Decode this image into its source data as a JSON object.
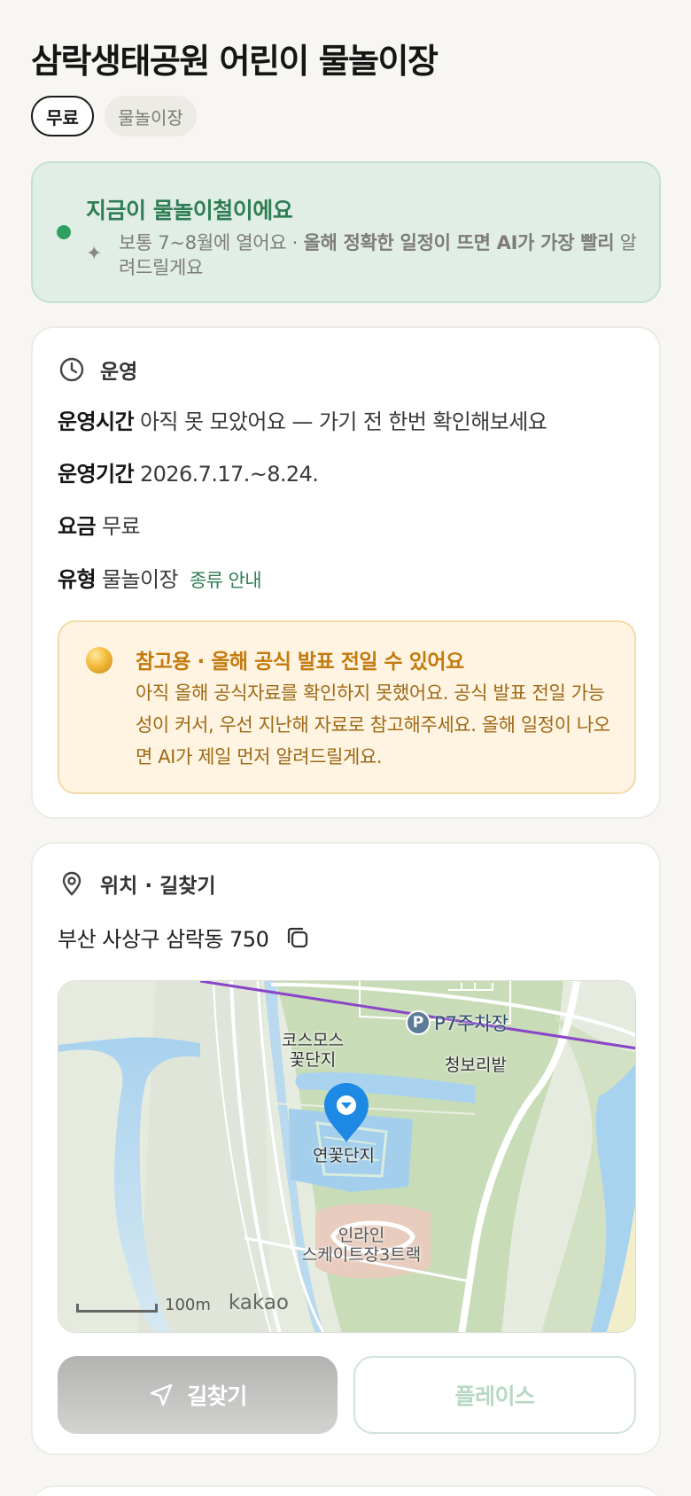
{
  "header": {
    "title": "삼락생태공원 어린이 물놀이장",
    "tags": [
      "무료",
      "물놀이장"
    ]
  },
  "season": {
    "title": "지금이 물놀이철이에요",
    "note_prefix": "보통 7~8월에 열어요 · ",
    "note_bold": "올해 정확한 일정이 뜨면 AI가 가장 빨리",
    "note_suffix": "알려드릴게요"
  },
  "operation": {
    "heading": "운영",
    "hours_key": "운영시간",
    "hours_value": "아직 못 모았어요 — 가기 전 한번 확인해보세요",
    "period_key": "운영기간",
    "period_value": "2026.7.17.~8.24.",
    "fee_key": "요금",
    "fee_value": "무료",
    "type_key": "유형",
    "type_value": "물놀이장",
    "type_link": "종류 안내",
    "notice_title": "참고용 · 올해 공식 발표 전일 수 있어요",
    "notice_body": "아직 올해 공식자료를 확인하지 못했어요. 공식 발표 전일 가능성이 커서, 우선 지난해 자료로 참고해주세요. 올해 일정이 나오면 AI가 제일 먼저 알려드릴게요."
  },
  "location": {
    "heading": "위치 · 길찾기",
    "address": "부산 사상구 삼락동 750",
    "map": {
      "labels": {
        "cosmos": "코스모스\n꽃단지",
        "blueberry": "청보리밭",
        "lotus": "연꽃단지",
        "inline_1": "인라인",
        "inline_2": "스케이트장3트랙",
        "parking": "P7주차장",
        "parking_badge": "P"
      },
      "scale": "100m",
      "brand": "kakao"
    },
    "route_button": "길찾기",
    "place_button": "플레이스"
  },
  "colors": {
    "accent_green": "#2f7d55",
    "warning_orange": "#c37a0c",
    "pin_blue": "#1e88e5",
    "route_purple": "#8a46c9"
  }
}
